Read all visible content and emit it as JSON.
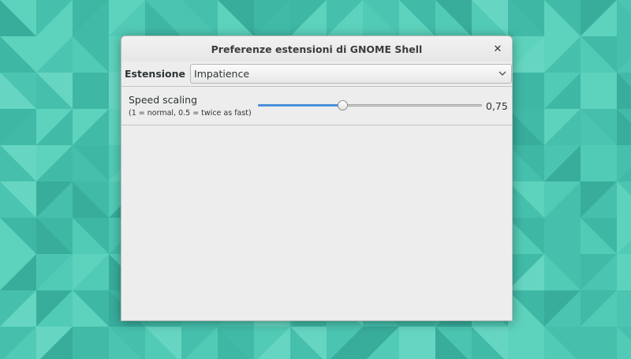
{
  "window": {
    "title": "Preferenze estensioni di GNOME Shell",
    "close_icon": "close-icon"
  },
  "extension_selector": {
    "label": "Estensione",
    "selected": "Impatience",
    "arrow_icon": "chevron-down-icon"
  },
  "settings": {
    "speed_scaling": {
      "title": "Speed scaling",
      "description": "(1 = normal, 0.5 = twice as fast)",
      "value_text": "0,75",
      "fill_fraction": 0.38
    }
  },
  "colors": {
    "accent": "#4a90d9",
    "wallpaper": "#4ec8b3"
  }
}
